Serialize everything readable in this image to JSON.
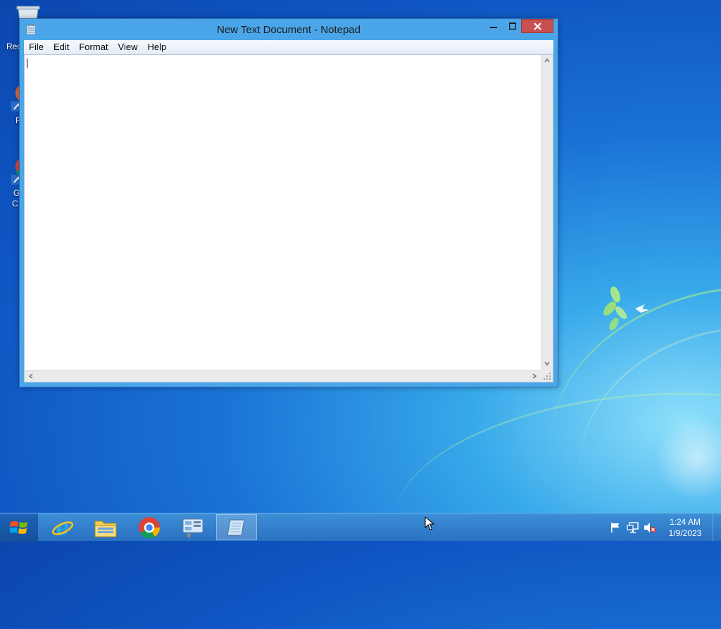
{
  "desktop": {
    "icons": [
      {
        "name": "recycle-bin",
        "label": "Rec"
      },
      {
        "name": "firefox",
        "label": "F"
      },
      {
        "name": "google-chrome",
        "label_line1": "G",
        "label_line2": "C"
      }
    ]
  },
  "window": {
    "title": "New Text Document - Notepad",
    "menu": [
      "File",
      "Edit",
      "Format",
      "View",
      "Help"
    ],
    "content": ""
  },
  "taskbar": {
    "pinned": [
      "internet-explorer-icon",
      "file-explorer-icon",
      "chrome-icon",
      "server-manager-icon",
      "notepad-icon"
    ],
    "clock": {
      "time": "1:24 AM",
      "date": "1/9/2023"
    }
  },
  "colors": {
    "window_frame": "#4aa6e8",
    "close_button": "#c75050",
    "taskbar": "#2f7bcc"
  }
}
